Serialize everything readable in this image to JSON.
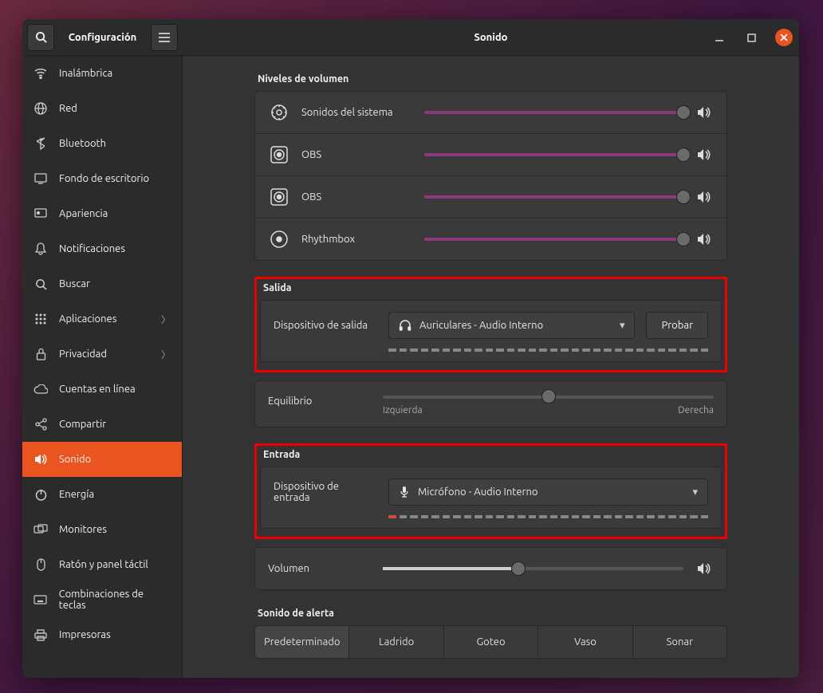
{
  "titlebar": {
    "app_title": "Configuración",
    "page_title": "Sonido"
  },
  "sidebar": {
    "items": [
      {
        "label": "Inalámbrica",
        "icon": "wifi"
      },
      {
        "label": "Red",
        "icon": "globe"
      },
      {
        "label": "Bluetooth",
        "icon": "bluetooth"
      },
      {
        "label": "Fondo de escritorio",
        "icon": "display"
      },
      {
        "label": "Apariencia",
        "icon": "appearance"
      },
      {
        "label": "Notificaciones",
        "icon": "bell"
      },
      {
        "label": "Buscar",
        "icon": "search"
      },
      {
        "label": "Aplicaciones",
        "icon": "apps",
        "chevron": true
      },
      {
        "label": "Privacidad",
        "icon": "lock",
        "chevron": true
      },
      {
        "label": "Cuentas en línea",
        "icon": "cloud"
      },
      {
        "label": "Compartir",
        "icon": "share"
      },
      {
        "label": "Sonido",
        "icon": "sound",
        "active": true
      },
      {
        "label": "Energía",
        "icon": "power"
      },
      {
        "label": "Monitores",
        "icon": "monitors"
      },
      {
        "label": "Ratón y panel táctil",
        "icon": "mouse"
      },
      {
        "label": "Combinaciones de teclas",
        "icon": "keyboard"
      },
      {
        "label": "Impresoras",
        "icon": "printer"
      }
    ]
  },
  "volume": {
    "section_title": "Niveles de volumen",
    "apps": [
      {
        "name": "Sonidos del sistema",
        "icon": "gear",
        "level": 100
      },
      {
        "name": "OBS",
        "icon": "obs",
        "level": 100
      },
      {
        "name": "OBS",
        "icon": "obs",
        "level": 100
      },
      {
        "name": "Rhythmbox",
        "icon": "rhythmbox",
        "level": 100
      }
    ]
  },
  "output": {
    "section_title": "Salida",
    "device_label": "Dispositivo de salida",
    "device_value": "Auriculares - Audio Interno",
    "test_button": "Probar",
    "balance_label": "Equilibrio",
    "balance_left": "Izquierda",
    "balance_right": "Derecha"
  },
  "input": {
    "section_title": "Entrada",
    "device_label": "Dispositivo de entrada",
    "device_value": "Micrófono - Audio Interno",
    "volume_label": "Volumen"
  },
  "alert": {
    "section_title": "Sonido de alerta",
    "options": [
      "Predeterminado",
      "Ladrido",
      "Goteo",
      "Vaso",
      "Sonar"
    ],
    "selected": 0
  }
}
